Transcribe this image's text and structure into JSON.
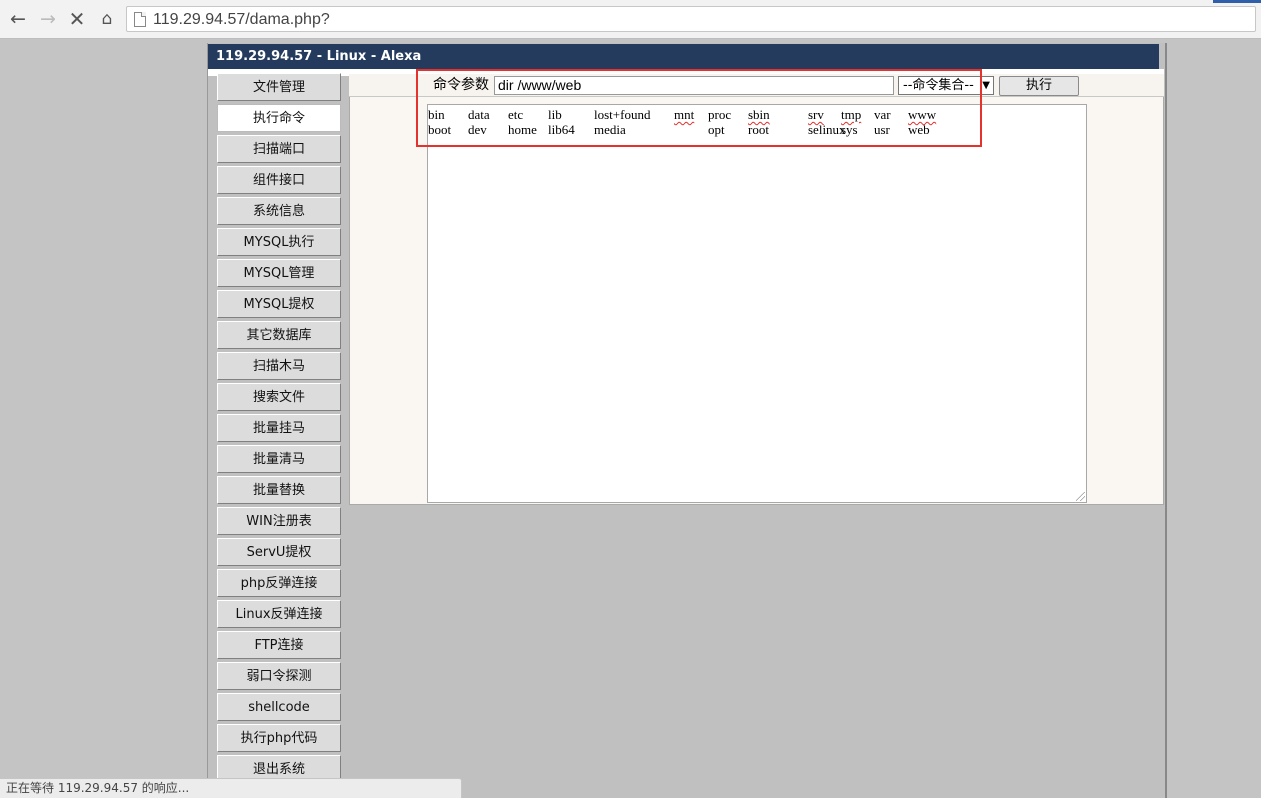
{
  "browser": {
    "url": "119.29.94.57/dama.php?",
    "back_icon": "arrow-left",
    "forward_icon": "arrow-right",
    "stop_icon": "close-x",
    "home_icon": "home"
  },
  "page": {
    "title": "119.29.94.57 - Linux - Alexa"
  },
  "sidebar": {
    "items": [
      {
        "label": "文件管理"
      },
      {
        "label": "执行命令",
        "active": true
      },
      {
        "label": "扫描端口"
      },
      {
        "label": "组件接口"
      },
      {
        "label": "系统信息"
      },
      {
        "label": "MYSQL执行"
      },
      {
        "label": "MYSQL管理"
      },
      {
        "label": "MYSQL提权"
      },
      {
        "label": "其它数据库"
      },
      {
        "label": "扫描木马"
      },
      {
        "label": "搜索文件"
      },
      {
        "label": "批量挂马"
      },
      {
        "label": "批量清马"
      },
      {
        "label": "批量替换"
      },
      {
        "label": "WIN注册表"
      },
      {
        "label": "ServU提权"
      },
      {
        "label": "php反弹连接"
      },
      {
        "label": "Linux反弹连接"
      },
      {
        "label": "FTP连接"
      },
      {
        "label": "弱口令探测"
      },
      {
        "label": "shellcode"
      },
      {
        "label": "执行php代码"
      },
      {
        "label": "退出系统"
      }
    ]
  },
  "command": {
    "label": "命令参数",
    "value": "dir /www/web",
    "select_value": "--命令集合--",
    "execute_label": "执行"
  },
  "output": {
    "rows": [
      [
        "bin",
        "data",
        "etc",
        "lib",
        "lost+found",
        "mnt",
        "proc",
        "sbin",
        "srv",
        "tmp",
        "var",
        "www"
      ],
      [
        "boot",
        "dev",
        "home",
        "lib64",
        "media",
        "",
        "opt",
        "root",
        "selinux",
        "sys",
        "usr",
        "web"
      ]
    ],
    "misspelled": [
      "mnt",
      "sbin",
      "srv",
      "tmp",
      "www"
    ]
  },
  "status": {
    "text": "正在等待 119.29.94.57 的响应..."
  },
  "colors": {
    "titlebar": "#243b5e",
    "highlight": "#e6322d",
    "page_bg": "#c4c4c4"
  }
}
